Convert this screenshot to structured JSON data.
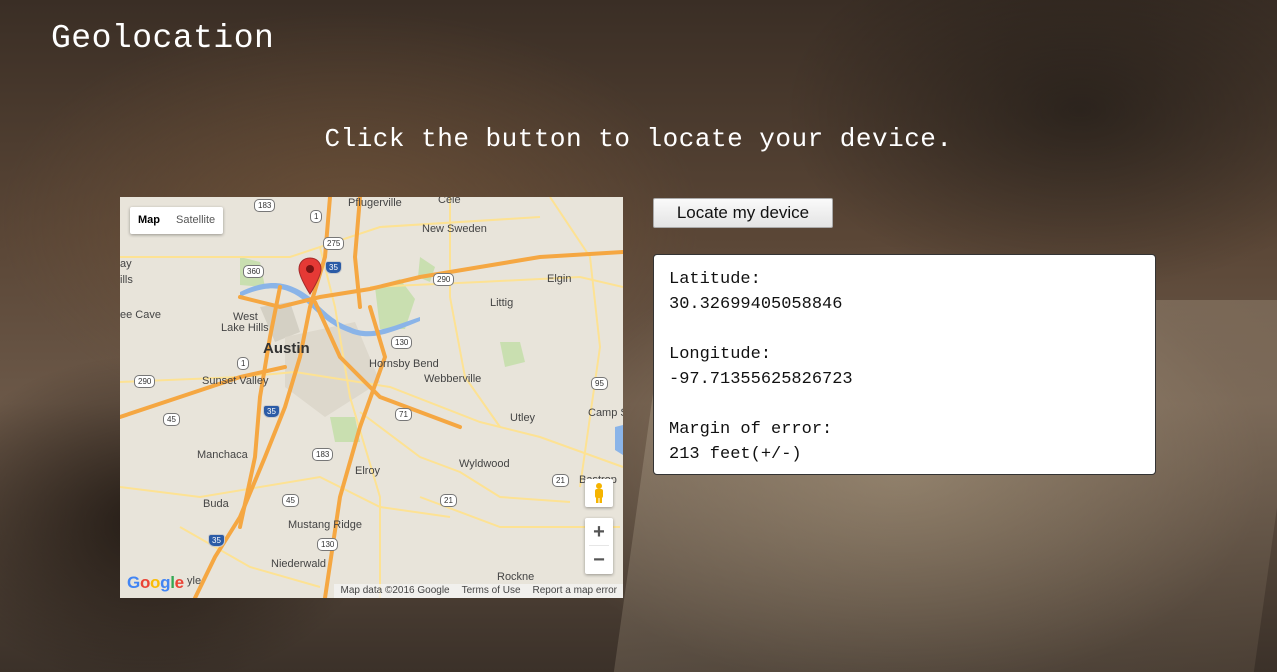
{
  "page": {
    "title": "Geolocation",
    "instruction": "Click the button to locate your device."
  },
  "locate_button": {
    "label": "Locate my device"
  },
  "results": {
    "latitude_label": "Latitude:",
    "latitude_value": "30.32699405058846",
    "longitude_label": "Longitude:",
    "longitude_value": "-97.71355625826723",
    "error_label": "Margin of error:",
    "error_value": "213 feet(+/-)"
  },
  "map": {
    "map_type": {
      "map_label": "Map",
      "satellite_label": "Satellite",
      "selected": "Map"
    },
    "zoom_in_label": "+",
    "zoom_out_label": "−",
    "places": {
      "austin": "Austin",
      "pflugerville": "Pflugerville",
      "cele": "Cele",
      "new_sweden": "New Sweden",
      "elgin": "Elgin",
      "littig": "Littig",
      "west_lake_hills_1": "West",
      "west_lake_hills_2": "Lake Hills",
      "bee_cave": "ee Cave",
      "sunset_valley": "Sunset Valley",
      "hornsby_bend": "Hornsby Bend",
      "webberville": "Webberville",
      "utley": "Utley",
      "camp_s": "Camp S",
      "manchaca": "Manchaca",
      "elroy": "Elroy",
      "wyldwood": "Wyldwood",
      "bastrop": "Bastrop",
      "buda": "Buda",
      "mustang_ridge": "Mustang Ridge",
      "niederwald": "Niederwald",
      "rockne": "Rockne",
      "ay": "ay",
      "ills": "ills",
      "yle": "yle"
    },
    "shields": [
      "183",
      "1",
      "275",
      "35",
      "360",
      "290",
      "130",
      "1",
      "290",
      "95",
      "35",
      "45",
      "71",
      "183",
      "21",
      "45",
      "21",
      "130",
      "35"
    ],
    "attribution": {
      "map_data": "Map data ©2016 Google",
      "terms": "Terms of Use",
      "report": "Report a map error"
    },
    "logo": "Google",
    "colors": {
      "land": "#e8e4da",
      "highway": "#f5a742",
      "road": "#fde293",
      "water": "#8ab4e8",
      "park": "#c9dfb0",
      "marker": "#e53935"
    }
  }
}
